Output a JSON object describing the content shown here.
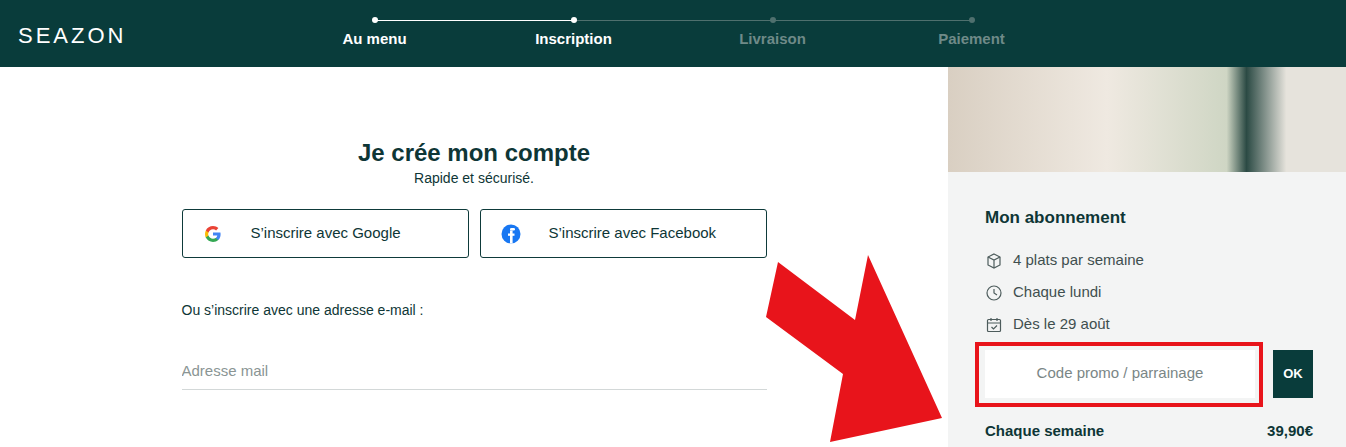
{
  "logo": "SEAZON",
  "steps": [
    {
      "label": "Au menu",
      "reached": true
    },
    {
      "label": "Inscription",
      "reached": true
    },
    {
      "label": "Livraison",
      "reached": false
    },
    {
      "label": "Paiement",
      "reached": false
    }
  ],
  "signup": {
    "title": "Je crée mon compte",
    "subtitle": "Rapide et sécurisé.",
    "social_buttons": [
      "S’inscrire avec Google",
      "S’inscrire avec Facebook"
    ],
    "email_prompt": "Ou s’inscrire avec une adresse e-mail :",
    "email_placeholder": "Adresse mail"
  },
  "subscription": {
    "title": "Mon abonnement",
    "items": [
      "4 plats par semaine",
      "Chaque lundi",
      "Dès le 29 août"
    ],
    "promo_placeholder": "Code promo / parrainage",
    "promo_button": "OK",
    "total_label": "Chaque semaine",
    "total_price": "39,90€"
  }
}
